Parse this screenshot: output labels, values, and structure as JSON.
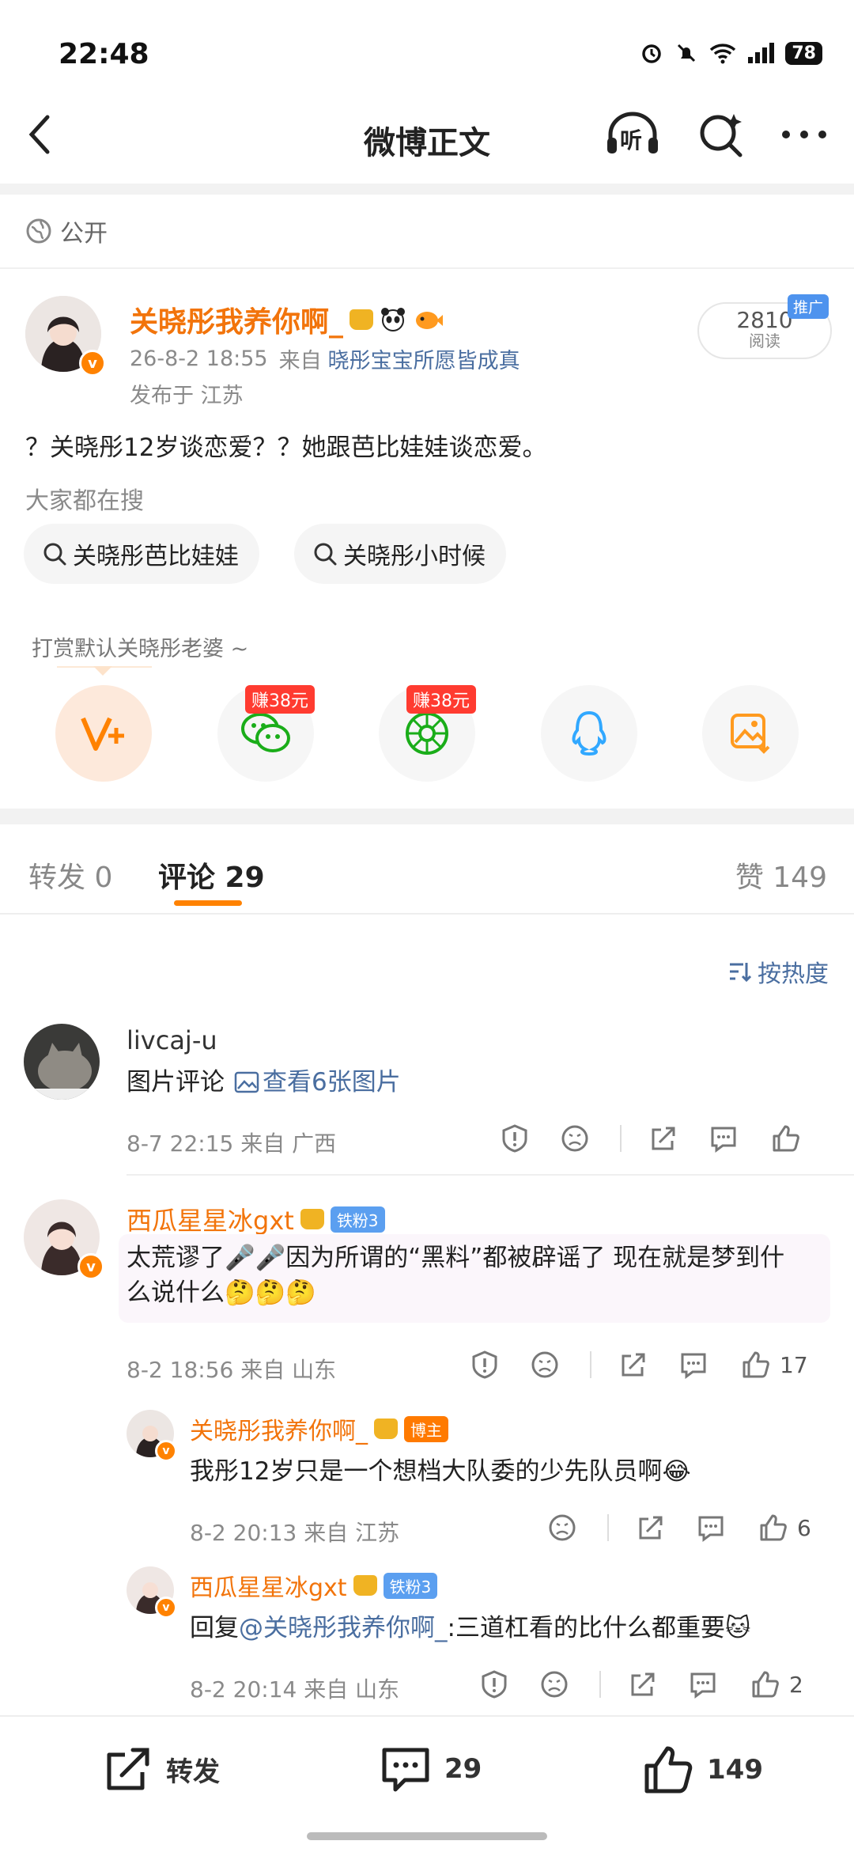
{
  "status_bar": {
    "time": "22:48",
    "battery": "78"
  },
  "nav": {
    "title": "微博正文",
    "listen_label": "听"
  },
  "visibility": {
    "label": "公开"
  },
  "post": {
    "author": "关晓彤我养你啊_",
    "time": "26-8-2 18:55",
    "from_prefix": "来自",
    "source": "晓彤宝宝所愿皆成真",
    "location": "发布于 江苏",
    "text": "？关晓彤12岁谈恋爱？？她跟芭比娃娃谈恋爱。",
    "reads": "2810",
    "reads_label": "阅读",
    "promo_tag": "推广"
  },
  "search": {
    "label": "大家都在搜",
    "chips": [
      "关晓彤芭比娃娃",
      "关晓彤小时候"
    ]
  },
  "tip": {
    "text": "打赏默认关晓彤老婆 ~"
  },
  "share": {
    "items": [
      {
        "name": "vplus-icon",
        "badge": ""
      },
      {
        "name": "wechat-icon",
        "badge": "赚38元"
      },
      {
        "name": "moments-icon",
        "badge": "赚38元"
      },
      {
        "name": "qq-icon",
        "badge": ""
      },
      {
        "name": "save-image-icon",
        "badge": ""
      }
    ]
  },
  "tabs": {
    "repost": "转发 0",
    "comments": "评论 29",
    "likes": "赞 149"
  },
  "sort": {
    "label": "按热度"
  },
  "comments": [
    {
      "name": "livcaj-u",
      "text_prefix": "图片评论",
      "link": "查看6张图片",
      "meta": "8-7 22:15 来自 广西"
    },
    {
      "name": "西瓜星星冰gxt",
      "fan_badge": "铁粉3",
      "text_line1": "太荒谬了🎤🎤因为所谓的“黑料”都被辟谣了 现在就是梦到什",
      "text_line2": "么说什么🤔🤔🤔",
      "meta": "8-2 18:56 来自 山东",
      "likes": "17",
      "replies": [
        {
          "name": "关晓彤我养你啊_",
          "badge": "博主",
          "text": "我彤12岁只是一个想档大队委的少先队员啊😂",
          "meta": "8-2 20:13 来自 江苏",
          "likes": "6"
        },
        {
          "name": "西瓜星星冰gxt",
          "badge": "铁粉3",
          "text_prefix": "回复",
          "mention": "@关晓彤我养你啊_",
          "text_suffix": ":三道杠看的比什么都重要🐱",
          "meta": "8-2 20:14 来自 山东",
          "likes": "2"
        }
      ]
    }
  ],
  "bottom_bar": {
    "repost": "转发",
    "comments": "29",
    "likes": "149"
  }
}
